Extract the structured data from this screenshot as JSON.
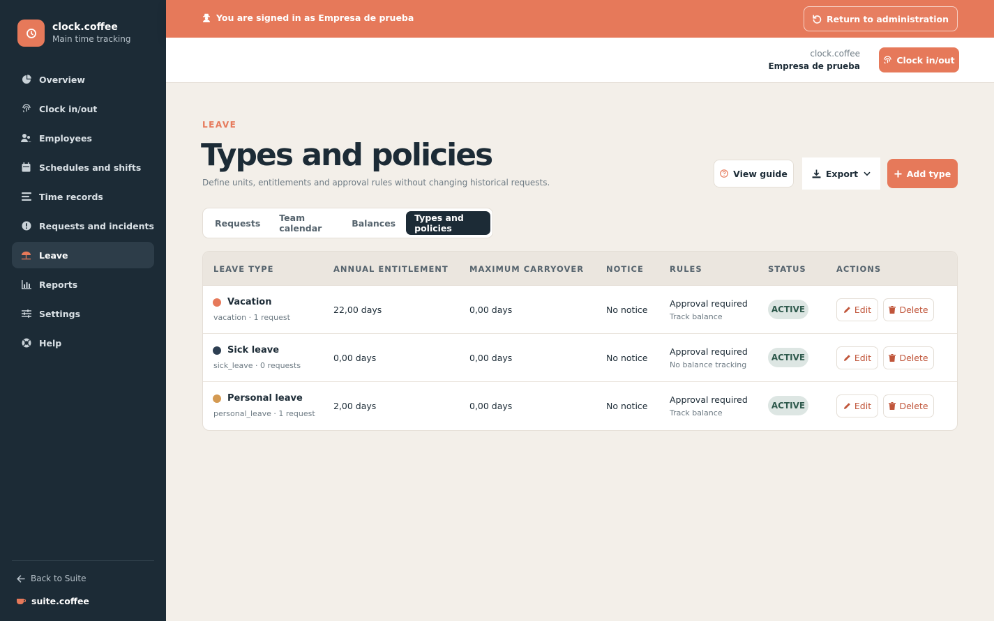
{
  "brand": {
    "name": "clock.coffee",
    "subtitle": "Main time tracking"
  },
  "sidebar": {
    "items": [
      {
        "label": "Overview",
        "icon": "pie-chart-icon"
      },
      {
        "label": "Clock in/out",
        "icon": "fingerprint-icon"
      },
      {
        "label": "Employees",
        "icon": "users-icon"
      },
      {
        "label": "Schedules and shifts",
        "icon": "calendar-icon"
      },
      {
        "label": "Time records",
        "icon": "list-icon"
      },
      {
        "label": "Requests and incidents",
        "icon": "alert-circle-icon"
      },
      {
        "label": "Leave",
        "icon": "umbrella-icon",
        "active": true
      },
      {
        "label": "Reports",
        "icon": "bar-chart-icon"
      },
      {
        "label": "Settings",
        "icon": "sliders-icon"
      },
      {
        "label": "Help",
        "icon": "help-circle-icon"
      }
    ],
    "back_label": "Back to Suite",
    "suite_label": "suite.coffee"
  },
  "banner": {
    "text": "You are signed in as Empresa de prueba",
    "return_label": "Return to administration"
  },
  "header": {
    "app": "clock.coffee",
    "company": "Empresa de prueba",
    "clock_label": "Clock in/out"
  },
  "main": {
    "eyebrow": "LEAVE",
    "title": "Types and policies",
    "subtitle": "Define units, entitlements and approval rules without changing historical requests.",
    "guide_label": "View guide",
    "export_label": "Export",
    "add_label": "Add type"
  },
  "tabs": [
    {
      "label": "Requests"
    },
    {
      "label": "Team calendar"
    },
    {
      "label": "Balances"
    },
    {
      "label": "Types and policies",
      "active": true
    }
  ],
  "table": {
    "headers": [
      "LEAVE TYPE",
      "ANNUAL ENTITLEMENT",
      "MAXIMUM CARRYOVER",
      "NOTICE",
      "RULES",
      "STATUS",
      "ACTIONS"
    ],
    "rows": [
      {
        "name": "Vacation",
        "meta": "vacation · 1 request",
        "color": "#e6795a",
        "entitlement": "22,00 days",
        "carryover": "0,00 days",
        "notice": "No notice",
        "rule": "Approval required",
        "rule_sub": "Track balance",
        "status": "ACTIVE"
      },
      {
        "name": "Sick leave",
        "meta": "sick_leave · 0 requests",
        "color": "#2d3f52",
        "entitlement": "0,00 days",
        "carryover": "0,00 days",
        "notice": "No notice",
        "rule": "Approval required",
        "rule_sub": "No balance tracking",
        "status": "ACTIVE"
      },
      {
        "name": "Personal leave",
        "meta": "personal_leave · 1 request",
        "color": "#d49a52",
        "entitlement": "2,00 days",
        "carryover": "0,00 days",
        "notice": "No notice",
        "rule": "Approval required",
        "rule_sub": "Track balance",
        "status": "ACTIVE"
      }
    ],
    "edit_label": "Edit",
    "delete_label": "Delete"
  },
  "colors": {
    "accent": "#e6795a",
    "sidebar": "#1c2b36",
    "background": "#f3efe9"
  }
}
